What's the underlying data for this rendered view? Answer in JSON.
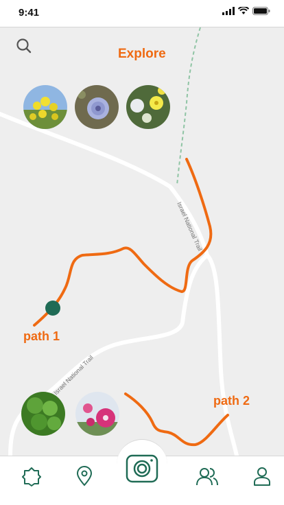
{
  "status": {
    "time": "9:41"
  },
  "map": {
    "title": "Explore",
    "trail_name": "Israel National Trail",
    "paths": [
      {
        "label": "path 1"
      },
      {
        "label": "path 2"
      }
    ]
  },
  "thumbnails_top": [
    {
      "name": "yellow-mustard-flowers"
    },
    {
      "name": "blue-chicory-flower"
    },
    {
      "name": "yellow-wood-sorrel-flowers"
    }
  ],
  "thumbnails_bottom": [
    {
      "name": "green-clover-leaves"
    },
    {
      "name": "pink-hollyhock-flowers"
    }
  ],
  "tab_bar": {
    "items": [
      "home",
      "location",
      "camera",
      "community",
      "profile"
    ]
  },
  "colors": {
    "accent": "#ef6a12",
    "primary_green": "#1f6b55",
    "road": "#ffffff"
  }
}
